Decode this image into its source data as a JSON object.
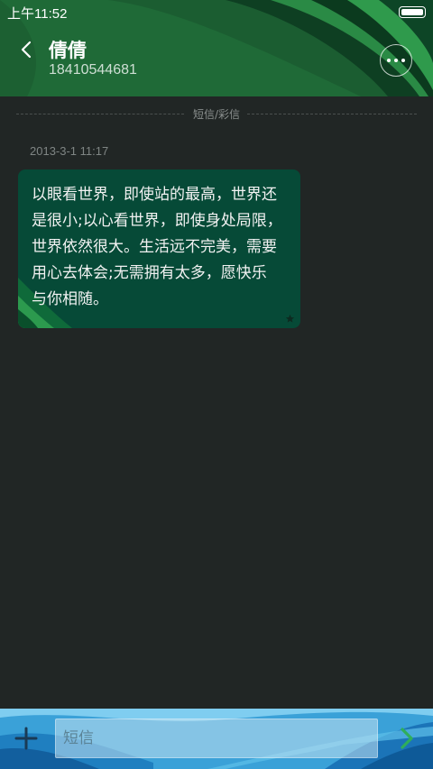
{
  "status_bar": {
    "time": "上午11:52",
    "battery_level": 1.0
  },
  "header": {
    "contact_name": "倩倩",
    "phone_number": "18410544681",
    "back_icon": "chevron-left-icon",
    "more_icon": "more-dots-icon"
  },
  "conversation": {
    "type_label": "短信/彩信",
    "messages": [
      {
        "timestamp": "2013-3-1 11:17",
        "text": "以眼看世界，即使站的最高，世界还\n是很小;以心看世界，即使身处局限，\n世界依然很大。生活远不完美，需要\n用心去体会;无需拥有太多，愿快乐\n与你相随。",
        "starred_icon": "star-icon"
      }
    ]
  },
  "input_bar": {
    "placeholder": "短信",
    "add_icon": "plus-icon",
    "send_icon": "send-chevron-icon"
  },
  "colors": {
    "header_green": "#1f6a37",
    "background": "#212625",
    "bubble": "#064a37",
    "input_bar_blue": "#2b8fc9",
    "send_green": "#2fae5a"
  }
}
